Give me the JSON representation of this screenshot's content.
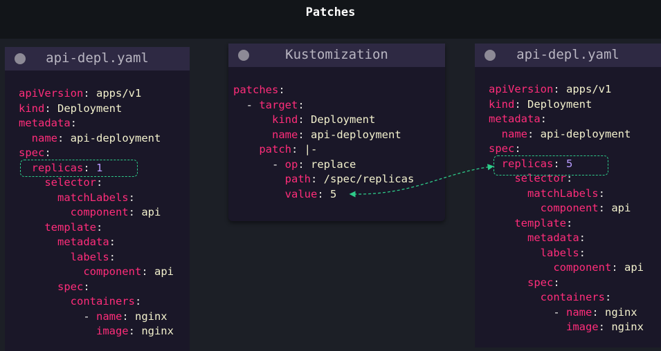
{
  "title": "Patches",
  "left_panel": {
    "title": "api-depl.yaml",
    "lines": [
      [
        [
          "apiVersion",
          "k"
        ],
        [
          ": ",
          "p"
        ],
        [
          "apps/v1",
          "v"
        ]
      ],
      [
        [
          "kind",
          "k"
        ],
        [
          ": ",
          "p"
        ],
        [
          "Deployment",
          "v"
        ]
      ],
      [
        [
          "metadata",
          "k"
        ],
        [
          ":",
          "p"
        ]
      ],
      [
        [
          "  name",
          "k"
        ],
        [
          ": ",
          "p"
        ],
        [
          "api-deployment",
          "v"
        ]
      ],
      [
        [
          "spec",
          "k"
        ],
        [
          ":",
          "p"
        ]
      ],
      [
        [
          "  replicas",
          "k"
        ],
        [
          ": ",
          "p"
        ],
        [
          "1",
          "n"
        ]
      ],
      [
        [
          "    selector",
          "k"
        ],
        [
          ":",
          "p"
        ]
      ],
      [
        [
          "      matchLabels",
          "k"
        ],
        [
          ":",
          "p"
        ]
      ],
      [
        [
          "        component",
          "k"
        ],
        [
          ": ",
          "p"
        ],
        [
          "api",
          "v"
        ]
      ],
      [
        [
          "    template",
          "k"
        ],
        [
          ":",
          "p"
        ]
      ],
      [
        [
          "      metadata",
          "k"
        ],
        [
          ":",
          "p"
        ]
      ],
      [
        [
          "        labels",
          "k"
        ],
        [
          ":",
          "p"
        ]
      ],
      [
        [
          "          component",
          "k"
        ],
        [
          ": ",
          "p"
        ],
        [
          "api",
          "v"
        ]
      ],
      [
        [
          "      spec",
          "k"
        ],
        [
          ":",
          "p"
        ]
      ],
      [
        [
          "        containers",
          "k"
        ],
        [
          ":",
          "p"
        ]
      ],
      [
        [
          "          - ",
          "p"
        ],
        [
          "name",
          "k"
        ],
        [
          ": ",
          "p"
        ],
        [
          "nginx",
          "v"
        ]
      ],
      [
        [
          "            image",
          "k"
        ],
        [
          ": ",
          "p"
        ],
        [
          "nginx",
          "v"
        ]
      ]
    ]
  },
  "middle_panel": {
    "title": "Kustomization",
    "lines": [
      [
        [
          "patches",
          "k"
        ],
        [
          ":",
          "p"
        ]
      ],
      [
        [
          "  - ",
          "p"
        ],
        [
          "target",
          "k"
        ],
        [
          ":",
          "p"
        ]
      ],
      [
        [
          "      kind",
          "k"
        ],
        [
          ": ",
          "p"
        ],
        [
          "Deployment",
          "v"
        ]
      ],
      [
        [
          "      name",
          "k"
        ],
        [
          ": ",
          "p"
        ],
        [
          "api-deployment",
          "v"
        ]
      ],
      [
        [
          "    patch",
          "k"
        ],
        [
          ": ",
          "p"
        ],
        [
          "|-",
          "v"
        ]
      ],
      [
        [
          "      - ",
          "p"
        ],
        [
          "op",
          "k"
        ],
        [
          ": ",
          "p"
        ],
        [
          "replace",
          "v"
        ]
      ],
      [
        [
          "        path",
          "k"
        ],
        [
          ": ",
          "p"
        ],
        [
          "/spec/replicas",
          "v"
        ]
      ],
      [
        [
          "        value",
          "k"
        ],
        [
          ": ",
          "p"
        ],
        [
          "5",
          "v"
        ]
      ]
    ]
  },
  "right_panel": {
    "title": "api-depl.yaml",
    "lines": [
      [
        [
          "apiVersion",
          "k"
        ],
        [
          ": ",
          "p"
        ],
        [
          "apps/v1",
          "v"
        ]
      ],
      [
        [
          "kind",
          "k"
        ],
        [
          ": ",
          "p"
        ],
        [
          "Deployment",
          "v"
        ]
      ],
      [
        [
          "metadata",
          "k"
        ],
        [
          ":",
          "p"
        ]
      ],
      [
        [
          "  name",
          "k"
        ],
        [
          ": ",
          "p"
        ],
        [
          "api-deployment",
          "v"
        ]
      ],
      [
        [
          "spec",
          "k"
        ],
        [
          ":",
          "p"
        ]
      ],
      [
        [
          "  replicas",
          "k"
        ],
        [
          ": ",
          "p"
        ],
        [
          "5",
          "n"
        ]
      ],
      [
        [
          "    selector",
          "k"
        ],
        [
          ":",
          "p"
        ]
      ],
      [
        [
          "      matchLabels",
          "k"
        ],
        [
          ":",
          "p"
        ]
      ],
      [
        [
          "        component",
          "k"
        ],
        [
          ": ",
          "p"
        ],
        [
          "api",
          "v"
        ]
      ],
      [
        [
          "    template",
          "k"
        ],
        [
          ":",
          "p"
        ]
      ],
      [
        [
          "      metadata",
          "k"
        ],
        [
          ":",
          "p"
        ]
      ],
      [
        [
          "        labels",
          "k"
        ],
        [
          ":",
          "p"
        ]
      ],
      [
        [
          "          component",
          "k"
        ],
        [
          ": ",
          "p"
        ],
        [
          "api",
          "v"
        ]
      ],
      [
        [
          "      spec",
          "k"
        ],
        [
          ":",
          "p"
        ]
      ],
      [
        [
          "        containers",
          "k"
        ],
        [
          ":",
          "p"
        ]
      ],
      [
        [
          "          - ",
          "p"
        ],
        [
          "name",
          "k"
        ],
        [
          ": ",
          "p"
        ],
        [
          "nginx",
          "v"
        ]
      ],
      [
        [
          "            image",
          "k"
        ],
        [
          ": ",
          "p"
        ],
        [
          "nginx",
          "v"
        ]
      ]
    ]
  },
  "colors": {
    "key": "#ff2d7a",
    "value": "#f3f1cd",
    "number": "#b89cff",
    "highlight": "#2ecc8a",
    "panel_bg": "#1a1728",
    "panel_header": "#2e2943"
  },
  "icons": {
    "panel_dot": "circle-dot-icon",
    "connector": "dashed-arrow-icon"
  }
}
